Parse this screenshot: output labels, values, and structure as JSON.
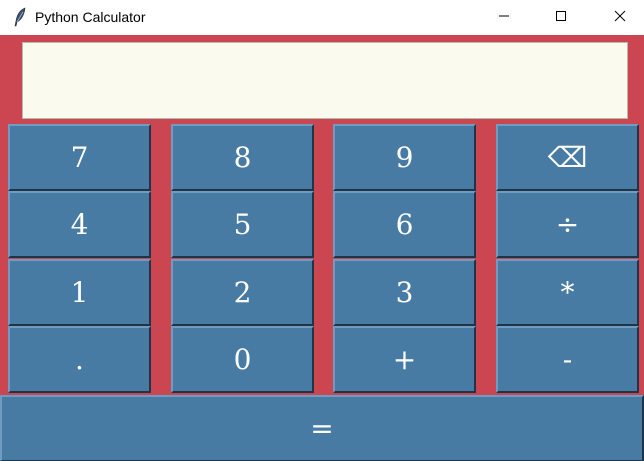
{
  "window": {
    "title": "Python Calculator",
    "icon": "feather-icon"
  },
  "titlebar_controls": {
    "minimize_icon": "minimize-icon",
    "maximize_icon": "maximize-icon",
    "close_icon": "close-icon"
  },
  "display": {
    "value": ""
  },
  "keys": {
    "k7": "7",
    "k8": "8",
    "k9": "9",
    "backspace": "⌫",
    "k4": "4",
    "k5": "5",
    "k6": "6",
    "divide": "÷",
    "k1": "1",
    "k2": "2",
    "k3": "3",
    "multiply": "*",
    "decimal": ".",
    "k0": "0",
    "plus": "+",
    "minus": "-",
    "equals": "="
  },
  "colors": {
    "background": "#cb4651",
    "key": "#487ba3",
    "display": "#fafbee",
    "key_text": "#ffffff"
  }
}
